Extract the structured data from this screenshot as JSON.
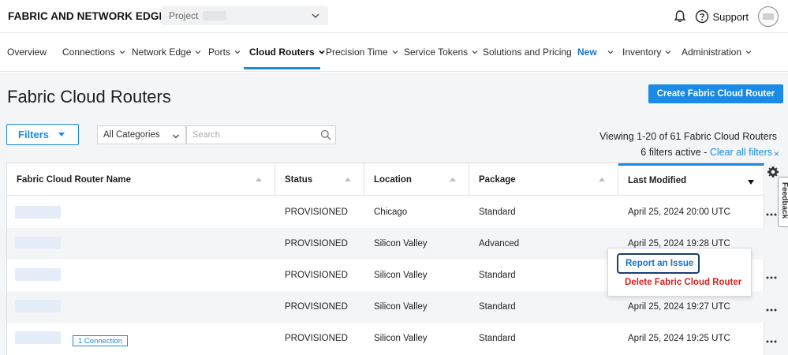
{
  "header": {
    "brand": "FABRIC AND NETWORK EDGE",
    "project_label": "Project",
    "support_label": "Support"
  },
  "nav": {
    "items": [
      {
        "label": "Overview",
        "has_chevron": false
      },
      {
        "label": "Connections",
        "has_chevron": true
      },
      {
        "label": "Network Edge",
        "has_chevron": true
      },
      {
        "label": "Ports",
        "has_chevron": true
      },
      {
        "label": "Cloud Routers",
        "has_chevron": true,
        "active": true
      },
      {
        "label": "Precision Time",
        "has_chevron": true
      },
      {
        "label": "Service Tokens",
        "has_chevron": true
      },
      {
        "label": "Solutions and Pricing",
        "has_chevron": false
      },
      {
        "label": "New",
        "has_chevron": true
      },
      {
        "label": "Inventory",
        "has_chevron": true
      },
      {
        "label": "Administration",
        "has_chevron": true
      }
    ]
  },
  "page": {
    "title": "Fabric Cloud Routers",
    "create_button": "Create Fabric Cloud Router",
    "filters_button": "Filters",
    "category_select": "All Categories",
    "search_placeholder": "Search",
    "viewing": "Viewing 1-20 of 61 Fabric Cloud Routers",
    "filters_active": "6 filters active - ",
    "clear_all": "Clear all filters",
    "clear_x": "×"
  },
  "table": {
    "columns": [
      "Fabric Cloud Router Name",
      "Status",
      "Location",
      "Package",
      "Last Modified"
    ],
    "rows": [
      {
        "status": "PROVISIONED",
        "location": "Chicago",
        "package": "Standard",
        "modified": "April 25, 2024 20:00 UTC",
        "badge": ""
      },
      {
        "status": "PROVISIONED",
        "location": "Silicon Valley",
        "package": "Advanced",
        "modified": "April 25, 2024 19:28 UTC",
        "badge": ""
      },
      {
        "status": "PROVISIONED",
        "location": "Silicon Valley",
        "package": "Standard",
        "modified": "",
        "badge": ""
      },
      {
        "status": "PROVISIONED",
        "location": "Silicon Valley",
        "package": "Standard",
        "modified": "April 25, 2024 19:27 UTC",
        "badge": ""
      },
      {
        "status": "PROVISIONED",
        "location": "Silicon Valley",
        "package": "Standard",
        "modified": "April 25, 2024 19:25 UTC",
        "badge": "1 Connection"
      }
    ]
  },
  "context_menu": {
    "report": "Report an Issue",
    "delete": "Delete Fabric Cloud Router"
  },
  "feedback_tab": "Feedback",
  "colors": {
    "accent": "#1a8ae6",
    "danger": "#d62020",
    "page_bg": "#f4f5f7"
  }
}
